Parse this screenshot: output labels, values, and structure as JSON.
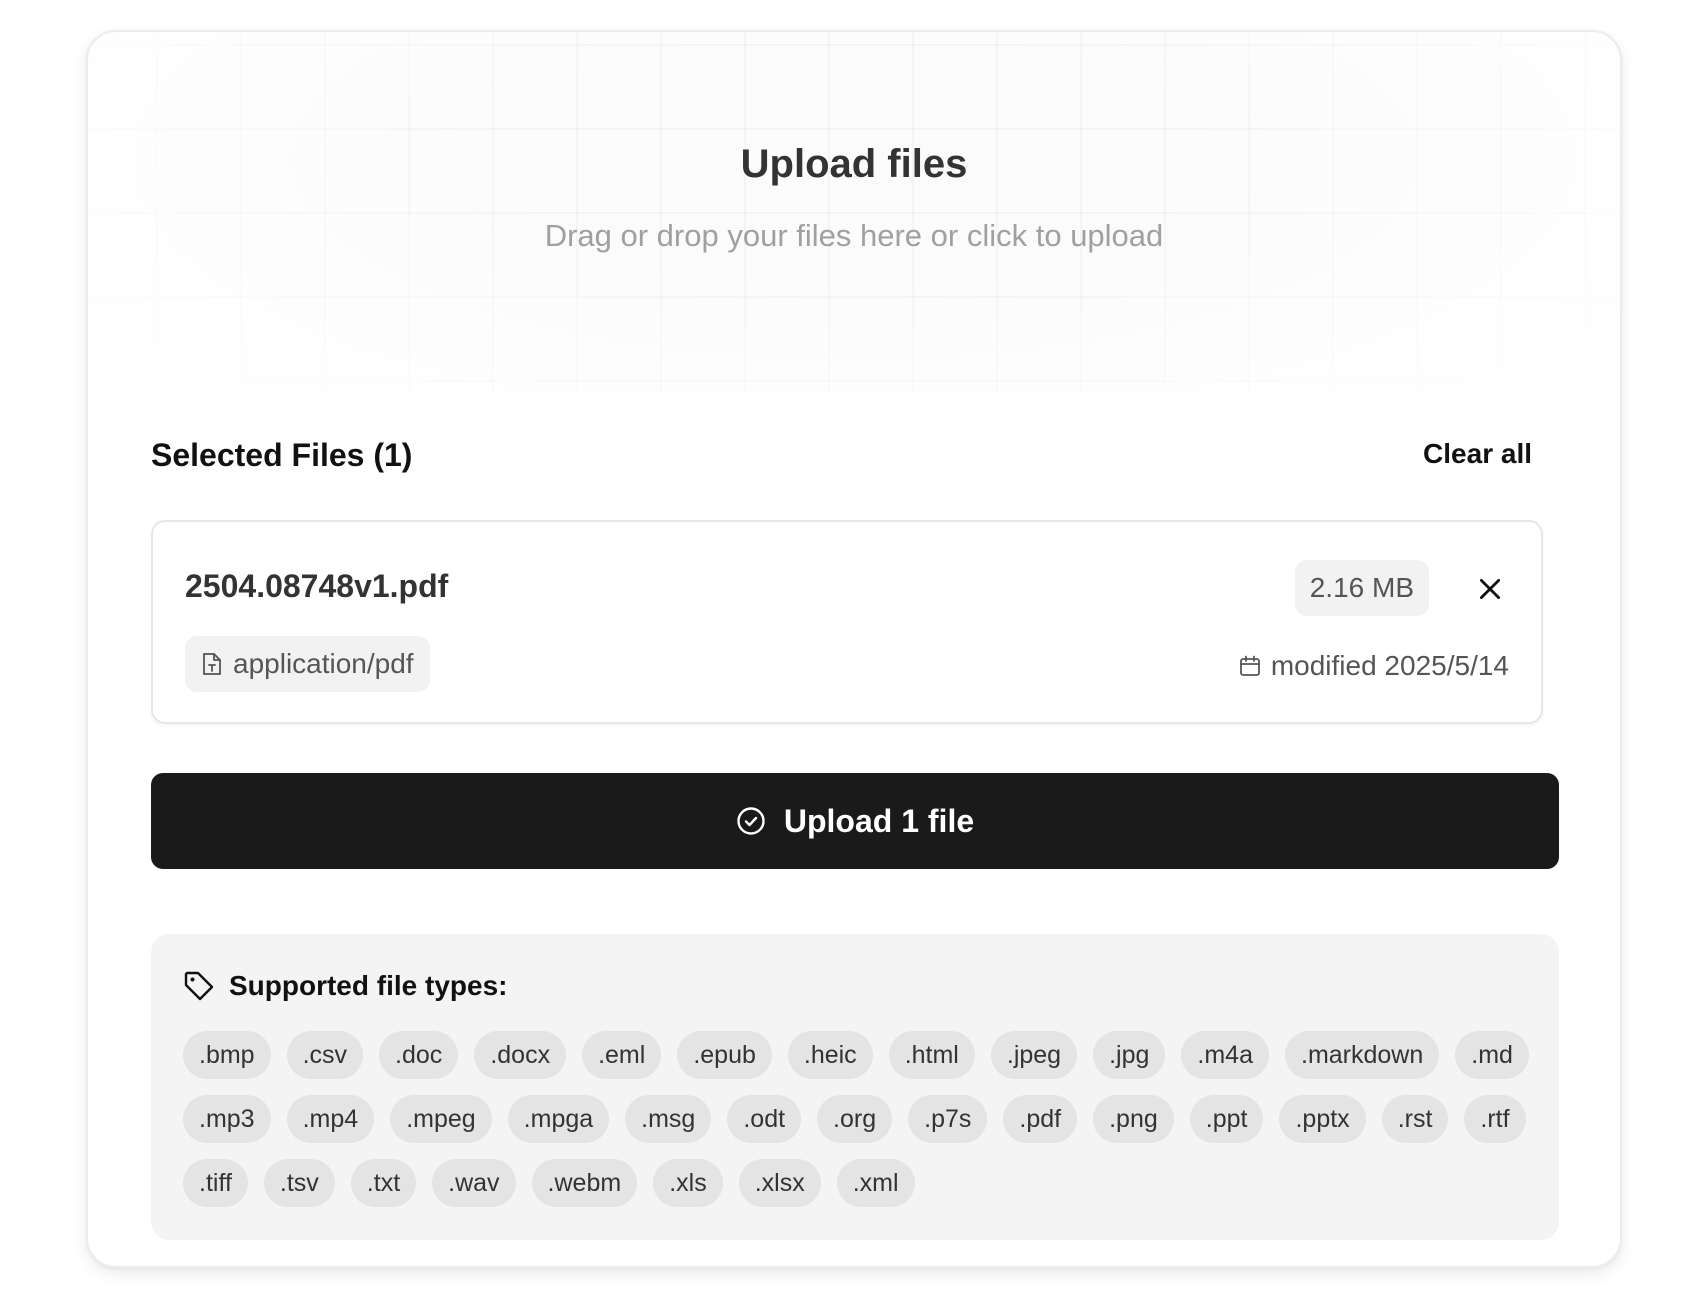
{
  "dropzone": {
    "title": "Upload files",
    "subtitle": "Drag or drop your files here or click to upload"
  },
  "selected": {
    "header": "Selected Files (1)",
    "clear_label": "Clear all"
  },
  "file": {
    "name": "2504.08748v1.pdf",
    "size": "2.16 MB",
    "mime": "application/pdf",
    "modified": "modified 2025/5/14"
  },
  "upload_button": {
    "label": "Upload 1 file"
  },
  "supported": {
    "title": "Supported file types:",
    "types": [
      ".bmp",
      ".csv",
      ".doc",
      ".docx",
      ".eml",
      ".epub",
      ".heic",
      ".html",
      ".jpeg",
      ".jpg",
      ".m4a",
      ".markdown",
      ".md",
      ".mp3",
      ".mp4",
      ".mpeg",
      ".mpga",
      ".msg",
      ".odt",
      ".org",
      ".p7s",
      ".pdf",
      ".png",
      ".ppt",
      ".pptx",
      ".rst",
      ".rtf",
      ".tiff",
      ".tsv",
      ".txt",
      ".wav",
      ".webm",
      ".xls",
      ".xlsx",
      ".xml"
    ]
  },
  "icons": {
    "remove": "close-icon",
    "mime": "file-type-icon",
    "modified": "calendar-icon",
    "upload": "check-circle-icon",
    "supported": "tag-icon"
  },
  "colors": {
    "primary_button": "#1a1a1a",
    "chip_bg": "#e4e4e4",
    "panel_bg": "#f4f4f4"
  }
}
